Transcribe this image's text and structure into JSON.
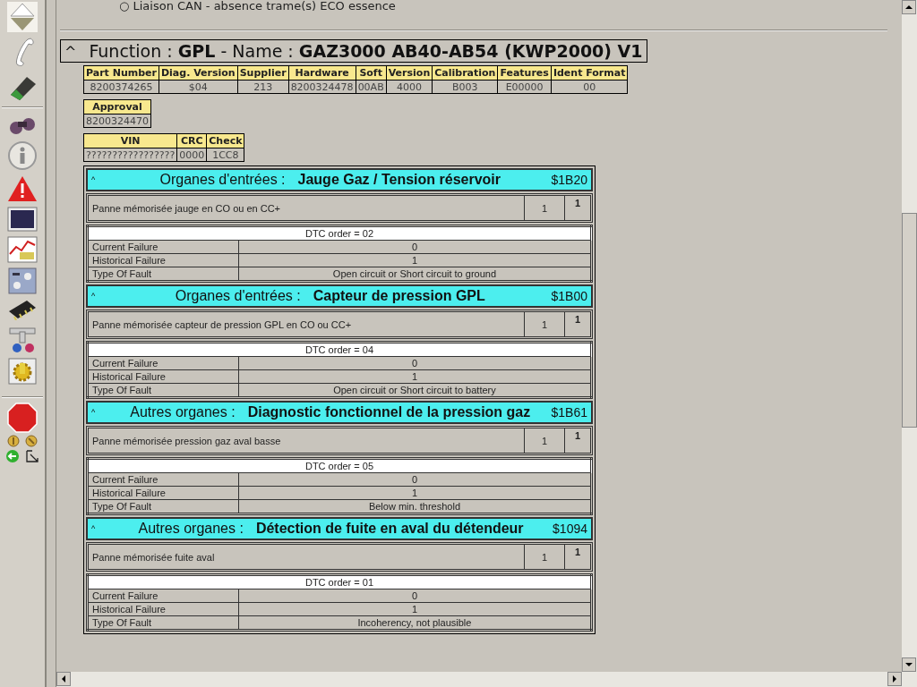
{
  "top_note": "○ Liaison CAN - absence trame(s) ECO essence",
  "function_title": {
    "caret": "^",
    "text": "Function : **GPL** - Name : **GAZ3000 AB40-AB54 (KWP2000) V1**"
  },
  "ident_tables": [
    {
      "columns": [
        "Part Number",
        "Diag. Version",
        "Supplier",
        "Hardware",
        "Soft",
        "Version",
        "Calibration",
        "Features",
        "Ident Format"
      ],
      "values": [
        "8200374265",
        "$04",
        "213",
        "8200324478",
        "00AB",
        "4000",
        "B003",
        "E00000",
        "00"
      ]
    },
    {
      "columns": [
        "Approval"
      ],
      "values": [
        "8200324470"
      ]
    },
    {
      "columns": [
        "VIN",
        "CRC",
        "Check"
      ],
      "values": [
        "?????????????????",
        "0000",
        "1CC8"
      ]
    }
  ],
  "sections": [
    {
      "caret": "^",
      "category": "Organes d'entrées :",
      "name": "Jauge Gaz / Tension réservoir",
      "code": "$1B20",
      "fault": {
        "text": "Panne mémorisée jauge en CO ou en CC+",
        "count": "1",
        "status": "1"
      },
      "dtc": {
        "title": "DTC order = 02",
        "rows": [
          {
            "label": "Current Failure",
            "value": "0"
          },
          {
            "label": "Historical Failure",
            "value": "1"
          },
          {
            "label": "Type Of Fault",
            "value": "Open circuit or Short circuit to ground"
          }
        ]
      }
    },
    {
      "caret": "^",
      "category": "Organes d'entrées :",
      "name": "Capteur de pression GPL",
      "code": "$1B00",
      "fault": {
        "text": "Panne mémorisée capteur de pression GPL en CO ou CC+",
        "count": "1",
        "status": "1"
      },
      "dtc": {
        "title": "DTC order = 04",
        "rows": [
          {
            "label": "Current Failure",
            "value": "0"
          },
          {
            "label": "Historical Failure",
            "value": "1"
          },
          {
            "label": "Type Of Fault",
            "value": "Open circuit or Short circuit to battery"
          }
        ]
      }
    },
    {
      "caret": "^",
      "category": "Autres organes :",
      "name": "Diagnostic fonctionnel de la pression gaz",
      "code": "$1B61",
      "fault": {
        "text": "Panne mémorisée pression gaz aval basse",
        "count": "1",
        "status": "1"
      },
      "dtc": {
        "title": "DTC order = 05",
        "rows": [
          {
            "label": "Current Failure",
            "value": "0"
          },
          {
            "label": "Historical Failure",
            "value": "1"
          },
          {
            "label": "Type Of Fault",
            "value": "Below min. threshold"
          }
        ]
      }
    },
    {
      "caret": "^",
      "category": "Autres organes :",
      "name": "Détection de fuite en aval du détendeur",
      "code": "$1094",
      "fault": {
        "text": "Panne mémorisée fuite aval",
        "count": "1",
        "status": "1"
      },
      "dtc": {
        "title": "DTC order = 01",
        "rows": [
          {
            "label": "Current Failure",
            "value": "0"
          },
          {
            "label": "Historical Failure",
            "value": "1"
          },
          {
            "label": "Type Of Fault",
            "value": "Incoherency, not plausible"
          }
        ]
      }
    }
  ]
}
